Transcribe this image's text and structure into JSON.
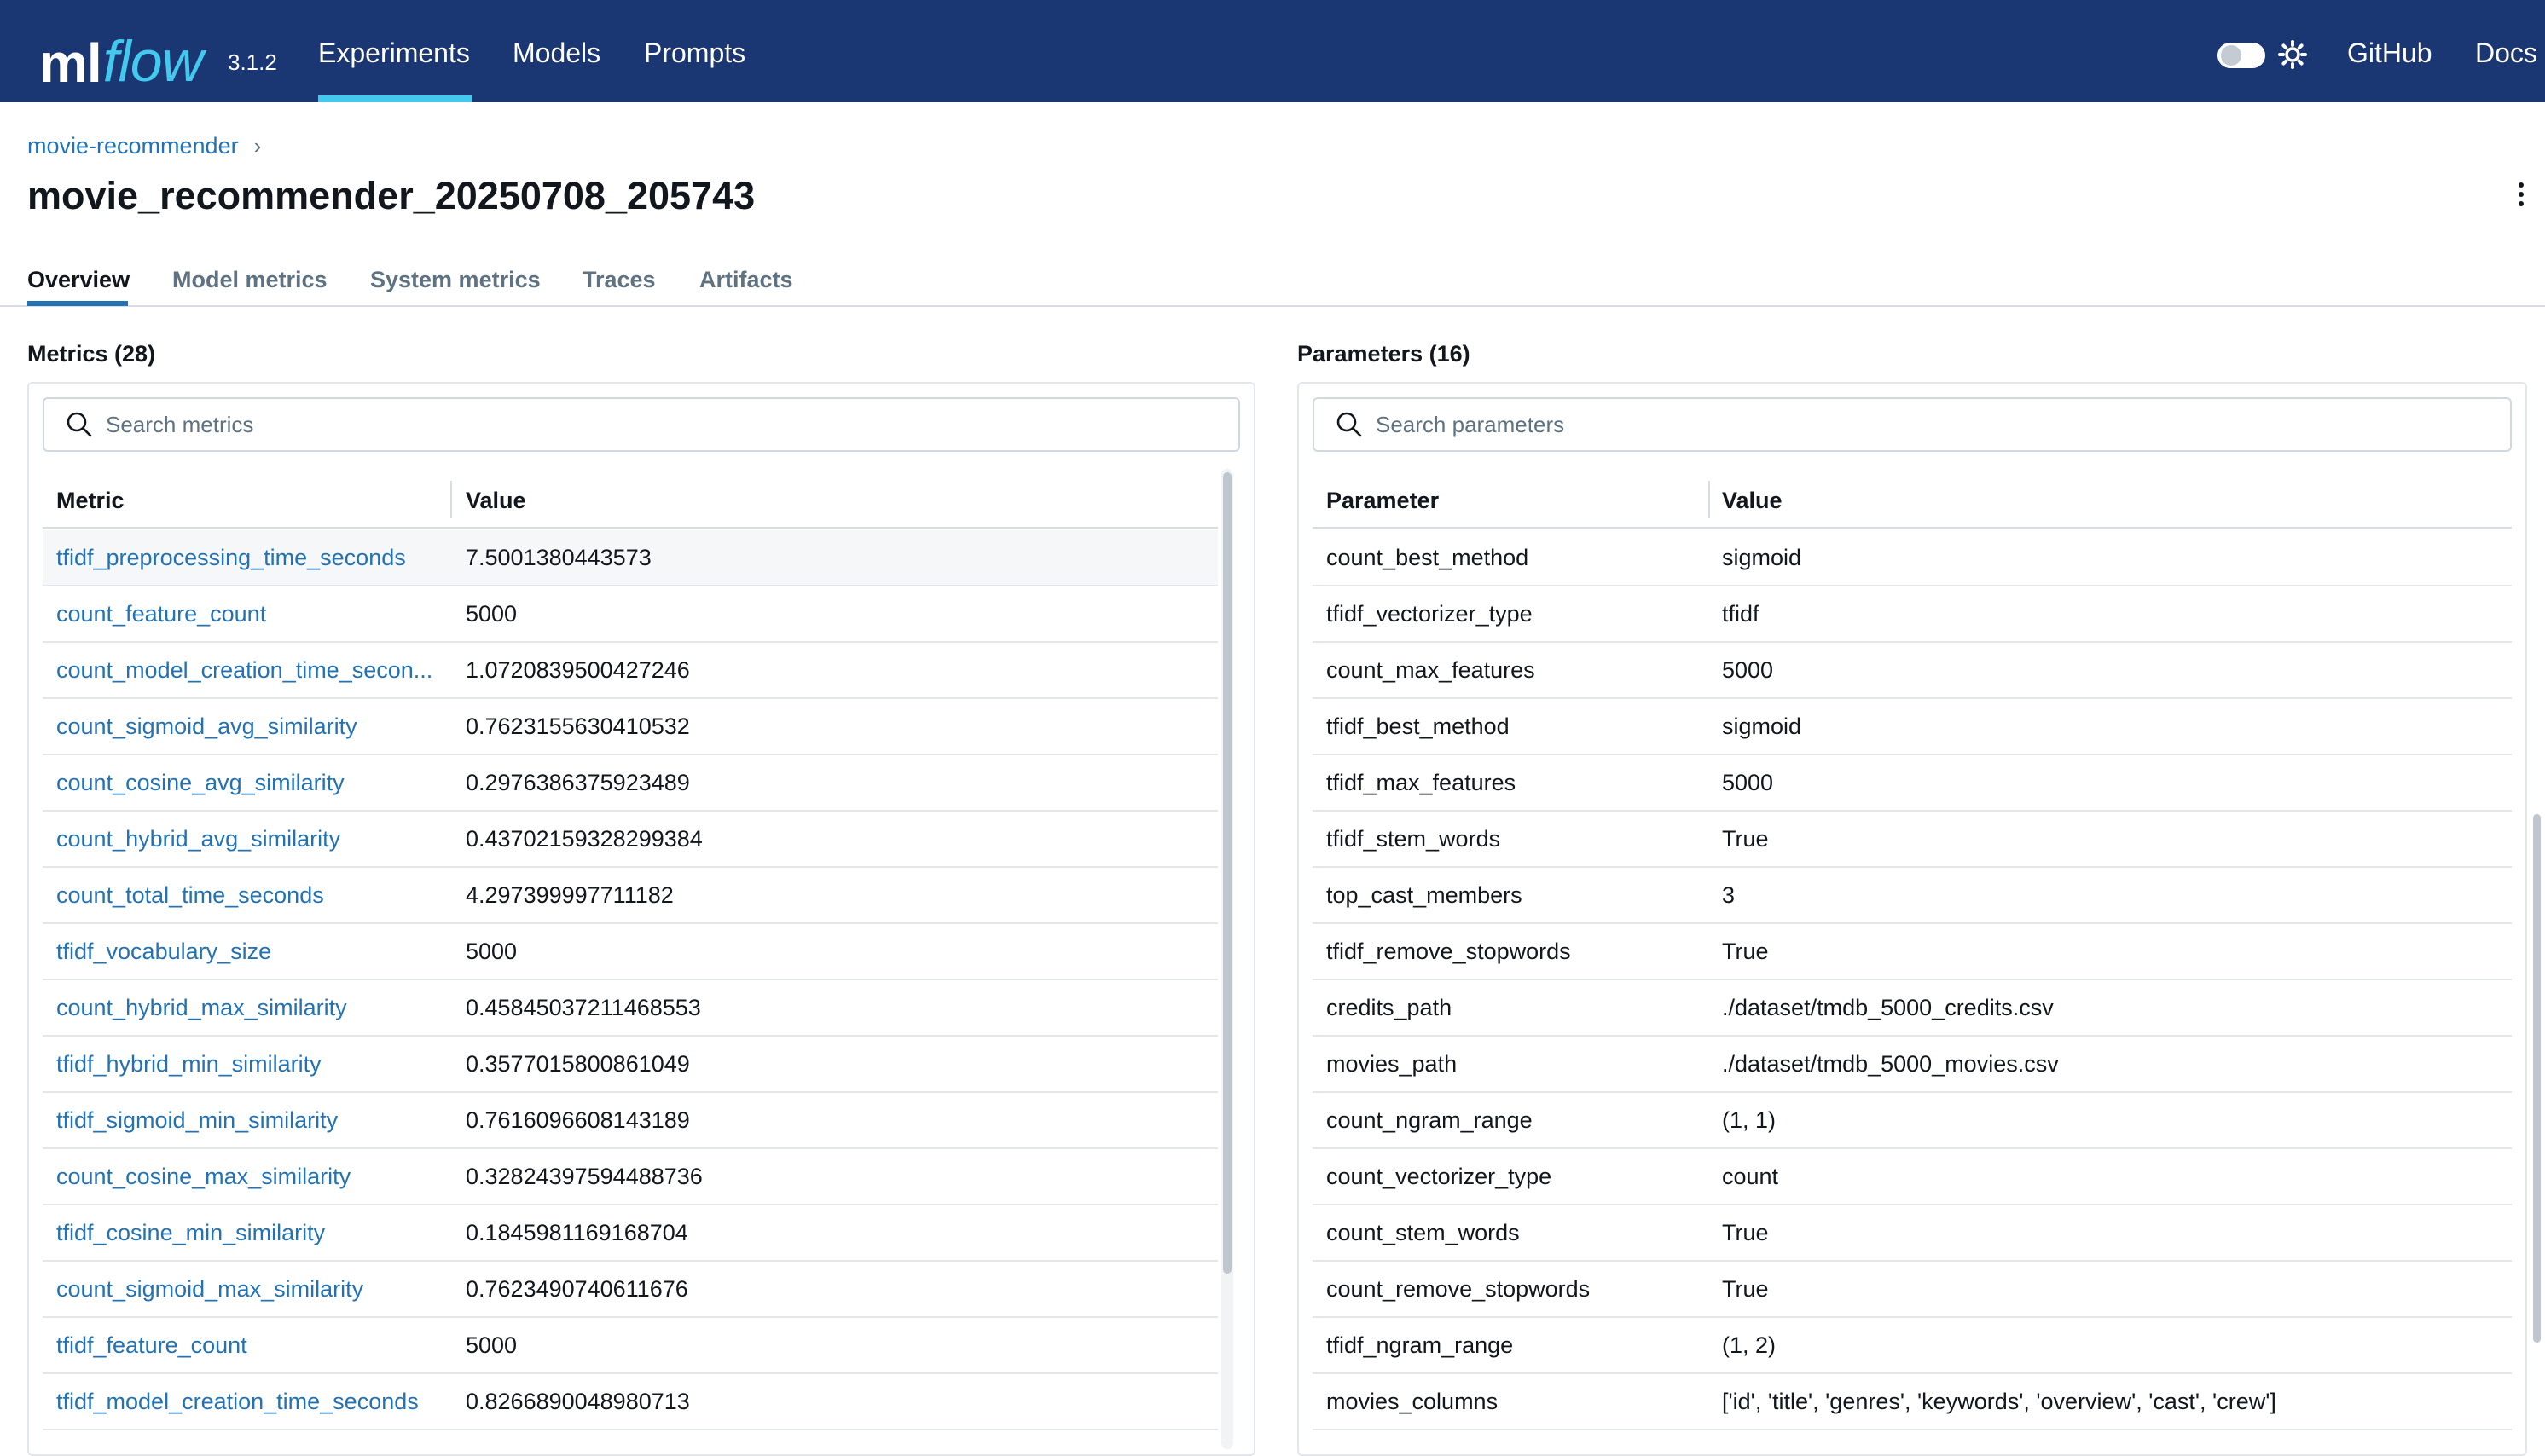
{
  "header": {
    "logo_ml": "ml",
    "logo_flow": "flow",
    "version": "3.1.2",
    "nav": {
      "experiments": "Experiments",
      "models": "Models",
      "prompts": "Prompts"
    },
    "github": "GitHub",
    "docs": "Docs",
    "brand_color": "#1b3773",
    "accent_color": "#43c9ed"
  },
  "breadcrumb": {
    "experiment": "movie-recommender",
    "separator": "›"
  },
  "page": {
    "title": "movie_recommender_20250708_205743"
  },
  "tabs": [
    {
      "label": "Overview",
      "active": true
    },
    {
      "label": "Model metrics",
      "active": false
    },
    {
      "label": "System metrics",
      "active": false
    },
    {
      "label": "Traces",
      "active": false
    },
    {
      "label": "Artifacts",
      "active": false
    }
  ],
  "metrics": {
    "title": "Metrics (28)",
    "search_placeholder": "Search metrics",
    "col_metric": "Metric",
    "col_value": "Value",
    "rows": [
      {
        "name": "tfidf_preprocessing_time_seconds",
        "value": "7.5001380443573"
      },
      {
        "name": "count_feature_count",
        "value": "5000"
      },
      {
        "name": "count_model_creation_time_secon...",
        "value": "1.0720839500427246"
      },
      {
        "name": "count_sigmoid_avg_similarity",
        "value": "0.7623155630410532"
      },
      {
        "name": "count_cosine_avg_similarity",
        "value": "0.2976386375923489"
      },
      {
        "name": "count_hybrid_avg_similarity",
        "value": "0.43702159328299384"
      },
      {
        "name": "count_total_time_seconds",
        "value": "4.297399997711182"
      },
      {
        "name": "tfidf_vocabulary_size",
        "value": "5000"
      },
      {
        "name": "count_hybrid_max_similarity",
        "value": "0.45845037211468553"
      },
      {
        "name": "tfidf_hybrid_min_similarity",
        "value": "0.3577015800861049"
      },
      {
        "name": "tfidf_sigmoid_min_similarity",
        "value": "0.7616096608143189"
      },
      {
        "name": "count_cosine_max_similarity",
        "value": "0.32824397594488736"
      },
      {
        "name": "tfidf_cosine_min_similarity",
        "value": "0.1845981169168704"
      },
      {
        "name": "count_sigmoid_max_similarity",
        "value": "0.7623490740611676"
      },
      {
        "name": "tfidf_feature_count",
        "value": "5000"
      },
      {
        "name": "tfidf_model_creation_time_seconds",
        "value": "0.8266890048980713"
      }
    ]
  },
  "parameters": {
    "title": "Parameters (16)",
    "search_placeholder": "Search parameters",
    "col_param": "Parameter",
    "col_value": "Value",
    "rows": [
      {
        "name": "count_best_method",
        "value": "sigmoid"
      },
      {
        "name": "tfidf_vectorizer_type",
        "value": "tfidf"
      },
      {
        "name": "count_max_features",
        "value": "5000"
      },
      {
        "name": "tfidf_best_method",
        "value": "sigmoid"
      },
      {
        "name": "tfidf_max_features",
        "value": "5000"
      },
      {
        "name": "tfidf_stem_words",
        "value": "True"
      },
      {
        "name": "top_cast_members",
        "value": "3"
      },
      {
        "name": "tfidf_remove_stopwords",
        "value": "True"
      },
      {
        "name": "credits_path",
        "value": "./dataset/tmdb_5000_credits.csv"
      },
      {
        "name": "movies_path",
        "value": "./dataset/tmdb_5000_movies.csv"
      },
      {
        "name": "count_ngram_range",
        "value": "(1, 1)"
      },
      {
        "name": "count_vectorizer_type",
        "value": "count"
      },
      {
        "name": "count_stem_words",
        "value": "True"
      },
      {
        "name": "count_remove_stopwords",
        "value": "True"
      },
      {
        "name": "tfidf_ngram_range",
        "value": "(1, 2)"
      },
      {
        "name": "movies_columns",
        "value": "['id', 'title', 'genres', 'keywords', 'overview', 'cast', 'crew']"
      }
    ]
  }
}
